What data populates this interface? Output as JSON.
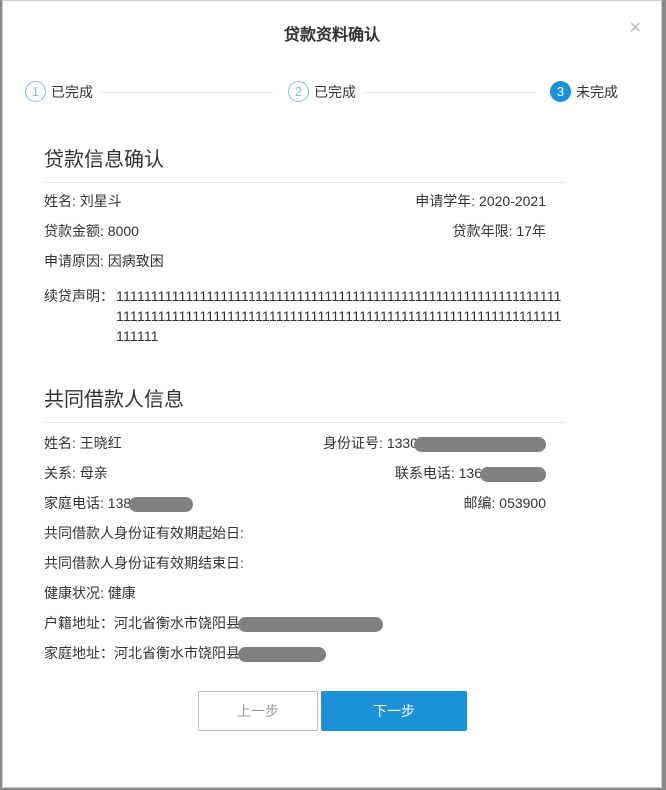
{
  "dialog": {
    "title": "贷款资料确认",
    "close": "×"
  },
  "steps": [
    {
      "num": "1",
      "label": "已完成"
    },
    {
      "num": "2",
      "label": "已完成"
    },
    {
      "num": "3",
      "label": "未完成"
    }
  ],
  "loan": {
    "title": "贷款信息确认",
    "name": "姓名: 刘星斗",
    "year": "申请学年: 2020-2021",
    "amount": "贷款金额: 8000",
    "term": "贷款年限: 17年",
    "reason": "申请原因: 因病致困",
    "decl_label": "续贷声明：",
    "decl_value": "11111111111111111111111111111111111111111111111111111111111111111111111111111111111111111111111111111111111111111111111111111111111111"
  },
  "coborrower": {
    "title": "共同借款人信息",
    "name": "姓名: 王晓红",
    "id": "身份证号: 1330",
    "relation": "关系: 母亲",
    "phone": "联系电话: 136",
    "home_phone": "家庭电话: 138",
    "zip": "邮编: 053900",
    "id_start": "共同借款人身份证有效期起始日:",
    "id_end": "共同借款人身份证有效期结束日:",
    "health": "健康状况: 健康",
    "hukou": "户籍地址：河北省衡水市饶阳县",
    "address": "家庭地址：河北省衡水市饶阳县"
  },
  "buttons": {
    "prev": "上一步",
    "next": "下一步"
  }
}
